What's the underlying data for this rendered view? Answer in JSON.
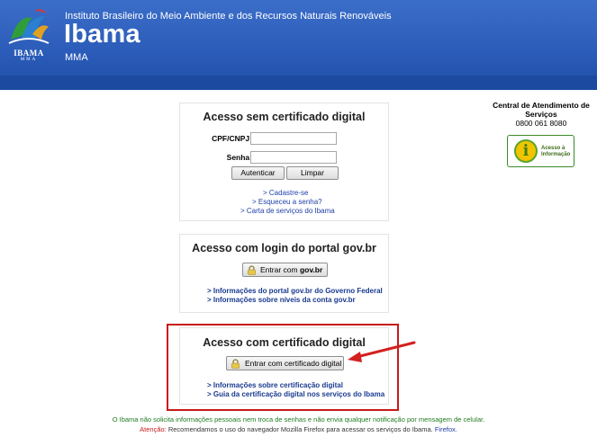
{
  "header": {
    "institute": "Instituto Brasileiro do Meio Ambiente e dos Recursos Naturais Renováveis",
    "brand": "Ibama",
    "ministry": "MMA",
    "logo_text": "IBAMA",
    "logo_sub": "MMA"
  },
  "side": {
    "title": "Central de Atendimento de Serviços",
    "phone": "0800 061 8080",
    "badge_icon": "i",
    "badge_label_1": "Acesso à",
    "badge_label_2": "Informação"
  },
  "panel_no_cert": {
    "title": "Acesso sem certificado digital",
    "cpf_label": "CPF/CNPJ:",
    "cpf_value": "",
    "password_label": "Senha:",
    "password_value": "",
    "authenticate_label": "Autenticar",
    "clear_label": "Limpar",
    "links": [
      "> Cadastre-se",
      "> Esqueceu a senha?",
      "> Carta de serviços do Ibama"
    ]
  },
  "panel_govbr": {
    "title": "Acesso com login do portal gov.br",
    "button_prefix": "Entrar com ",
    "button_brand": "gov.br",
    "links": [
      "> Informações do portal gov.br do Governo Federal",
      "> Informações sobre níveis da conta gov.br"
    ]
  },
  "panel_cert": {
    "title": "Acesso com certificado digital",
    "button_label": "Entrar com certificado digital",
    "links": [
      "> Informações sobre certificação digital",
      "> Guia da certificação digital nos serviços do Ibama"
    ]
  },
  "footer": {
    "notice": "O Ibama não solicita informações pessoais nem troca de senhas e não envia qualquer notificação por mensagem de celular.",
    "warning_label": "Atenção:",
    "warning_text": " Recomendamos o uso do navegador Mozilla Firefox para acessar os serviços do Ibama. ",
    "firefox_link": "Firefox."
  },
  "colors": {
    "header_blue": "#2a5bb8",
    "highlight_red": "#c71a1a",
    "link_blue": "#1f3fa8",
    "notice_green": "#1f7a1f"
  }
}
